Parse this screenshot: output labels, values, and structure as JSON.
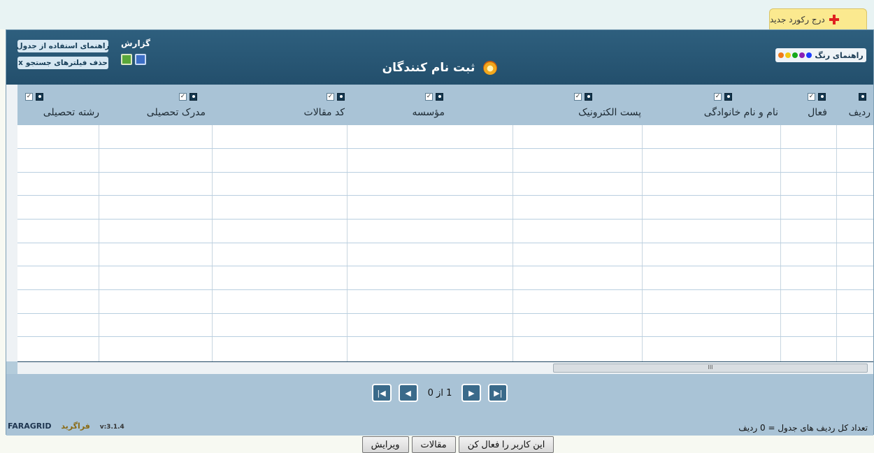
{
  "new_record": {
    "label": "درج رکورد جدید"
  },
  "grid": {
    "title": "ثبت نام کنندگان",
    "report_label": "گزارش",
    "table_help_button": "راهنمای استفاده از جدول",
    "clear_filters_button": "حذف فیلترهای جستجو",
    "clear_filters_x": "x",
    "color_guide_label": "راهنمای رنگ",
    "color_dots": [
      "#1a3cff",
      "#8a1fb4",
      "#15a81a",
      "#f0c814",
      "#f07a18"
    ],
    "columns": [
      {
        "label": "ردیف"
      },
      {
        "label": "فعال"
      },
      {
        "label": "نام و نام خانوادگی"
      },
      {
        "label": "پست الکترونیک"
      },
      {
        "label": "مؤسسه"
      },
      {
        "label": "کد مقالات"
      },
      {
        "label": "مدرک تحصیلی"
      },
      {
        "label": "رشته تحصیلی"
      }
    ],
    "scroll_thumb": "III"
  },
  "pager": {
    "info": "1 از 0"
  },
  "footer": {
    "total": "تعداد کل ردیف های جدول = 0 ردیف",
    "brand_en": "FARAGRID",
    "brand_fa": "فراگرید",
    "version": "v:3.1.4"
  },
  "actions": {
    "activate": "این کاربر را فعال کن",
    "articles": "مقالات",
    "edit": "ویرایش"
  }
}
